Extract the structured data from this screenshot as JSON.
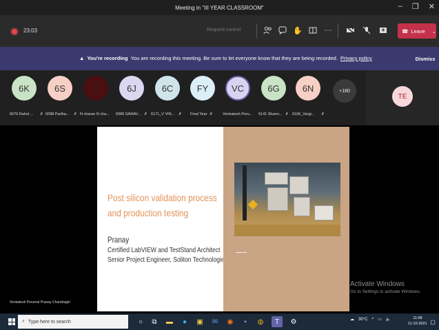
{
  "window": {
    "title": "Meeting in \"III YEAR CLASSROOM\""
  },
  "toolbar": {
    "timer": "23:03",
    "request_control": "Request control",
    "leave_label": "Leave"
  },
  "banner": {
    "heading": "You're recording",
    "message": "You are recording this meeting. Be sure to let everyone know that they are being recorded.",
    "link": "Privacy policy",
    "dismiss": "Dismiss"
  },
  "participants": [
    {
      "initials": "6K",
      "name": "6079 Rahul ...",
      "color": "#c9e3c6"
    },
    {
      "initials": "6S",
      "name": "6098 Partha...",
      "color": "#f7cfc4"
    },
    {
      "initials": "",
      "name": "N charan N cha...",
      "color": "#4a1010"
    },
    {
      "initials": "6J",
      "name": "6089 SARAV...",
      "color": "#dcd7f0"
    },
    {
      "initials": "6C",
      "name": "6171_V VIN...",
      "color": "#cfe5ea"
    },
    {
      "initials": "FY",
      "name": "Final Year",
      "color": "#dceef6"
    },
    {
      "initials": "VC",
      "name": "Venkatesh Peru...",
      "color": "#d9d3f2"
    },
    {
      "initials": "6G",
      "name": "6141 Sharm...",
      "color": "#c9e3c6"
    },
    {
      "initials": "6N",
      "name": "6166_Vargi...",
      "color": "#f7cfc4"
    }
  ],
  "more_participants": "+180",
  "self": {
    "initials": "TE",
    "color": "#f8d7dc"
  },
  "slide": {
    "title_line1": "Post silicon validation process",
    "title_line2": "and production testing",
    "presenter": "Pranay",
    "role1": "Certified LabVIEW and TestStand Architect",
    "role2": "Senior Project Engineer, Soliton Technologies"
  },
  "presenter_caption": "Venkatesh Perumal Pranay Chandragiri",
  "watermark": {
    "line1": "Activate Windows",
    "line2": "Go to Settings to activate Windows."
  },
  "taskbar": {
    "search_placeholder": "Type here to search",
    "temperature": "30°C",
    "time": "11:08",
    "date": "11-10-2021"
  },
  "colors": {
    "accent": "#6264a7",
    "leave": "#c4314b",
    "recording": "#e0474c"
  }
}
